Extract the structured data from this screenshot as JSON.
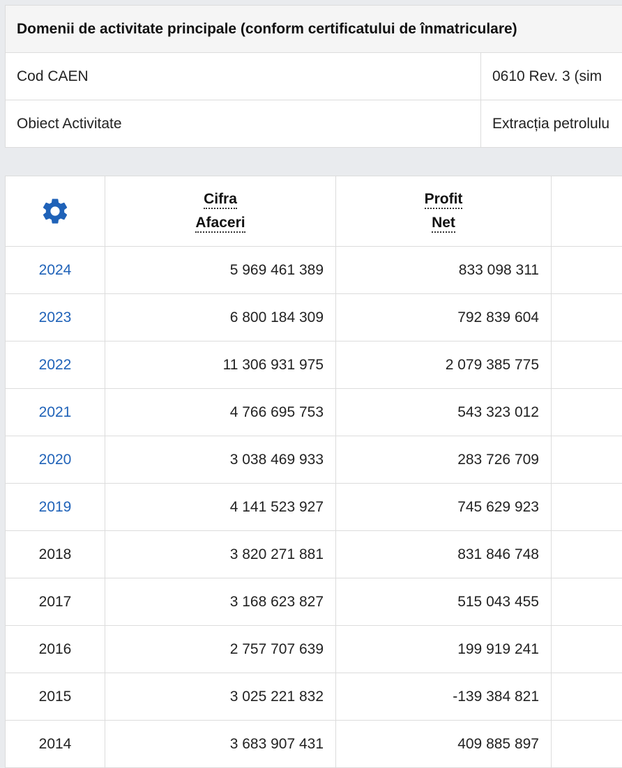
{
  "info_panel": {
    "title": "Domenii de activitate principale (conform certificatului de înmatriculare)",
    "rows": [
      {
        "label": "Cod CAEN",
        "value": "0610 Rev. 3  (sim"
      },
      {
        "label": "Obiect Activitate",
        "value": "Extracția petrolulu"
      }
    ]
  },
  "financial_table": {
    "header": {
      "settings_icon": "gear-icon",
      "cifra_afaceri_line1": "Cifra",
      "cifra_afaceri_line2": "Afaceri",
      "profit_net_line1": "Profit",
      "profit_net_line2": "Net"
    },
    "rows": [
      {
        "year": "2024",
        "cifra_afaceri": "5 969 461 389",
        "profit_net": "833 098 311",
        "is_link": true
      },
      {
        "year": "2023",
        "cifra_afaceri": "6 800 184 309",
        "profit_net": "792 839 604",
        "is_link": true
      },
      {
        "year": "2022",
        "cifra_afaceri": "11 306 931 975",
        "profit_net": "2 079 385 775",
        "is_link": true
      },
      {
        "year": "2021",
        "cifra_afaceri": "4 766 695 753",
        "profit_net": "543 323 012",
        "is_link": true
      },
      {
        "year": "2020",
        "cifra_afaceri": "3 038 469 933",
        "profit_net": "283 726 709",
        "is_link": true
      },
      {
        "year": "2019",
        "cifra_afaceri": "4 141 523 927",
        "profit_net": "745 629 923",
        "is_link": true
      },
      {
        "year": "2018",
        "cifra_afaceri": "3 820 271 881",
        "profit_net": "831 846 748",
        "is_link": false
      },
      {
        "year": "2017",
        "cifra_afaceri": "3 168 623 827",
        "profit_net": "515 043 455",
        "is_link": false
      },
      {
        "year": "2016",
        "cifra_afaceri": "2 757 707 639",
        "profit_net": "199 919 241",
        "is_link": false
      },
      {
        "year": "2015",
        "cifra_afaceri": "3 025 221 832",
        "profit_net": "-139 384 821",
        "is_link": false
      },
      {
        "year": "2014",
        "cifra_afaceri": "3 683 907 431",
        "profit_net": "409 885 897",
        "is_link": false
      }
    ]
  },
  "colors": {
    "link": "#1f62b8",
    "gear": "#1f62b8",
    "border": "#dcdcdc",
    "header_bg": "#f5f5f5",
    "page_bg": "#e9ebee"
  }
}
